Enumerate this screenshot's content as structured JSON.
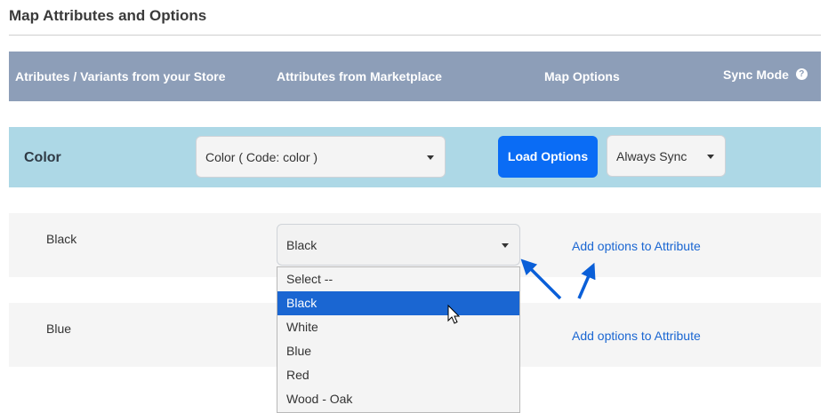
{
  "section_title": "Map Attributes and Options",
  "header": {
    "col1": "Atributes / Variants from your Store",
    "col2": "Attributes from Marketplace",
    "col3": "Map Options",
    "col4": "Sync Mode",
    "help_glyph": "?"
  },
  "attribute_row": {
    "label": "Color",
    "marketplace_select_value": "Color ( Code: color )",
    "load_button_label": "Load Options",
    "sync_select_value": "Always Sync"
  },
  "option_rows": [
    {
      "label": "Black",
      "select_value": "Black",
      "link_label": "Add options to Attribute"
    },
    {
      "label": "Blue",
      "link_label": "Add options to Attribute"
    }
  ],
  "dropdown": {
    "items": [
      "Select --",
      "Black",
      "White",
      "Blue",
      "Red",
      "Wood - Oak"
    ],
    "highlighted": "Black"
  },
  "colors": {
    "header_bg": "#8d9eb8",
    "attr_row_bg": "#add8e6",
    "primary_button": "#0a6cf5",
    "link": "#1a66d2",
    "arrow": "#0a5fd8"
  }
}
